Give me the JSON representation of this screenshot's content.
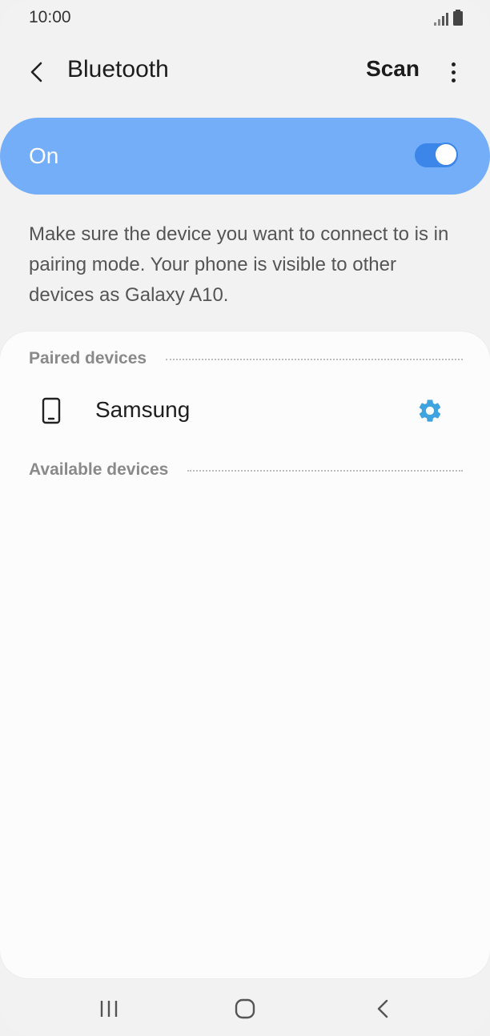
{
  "status_bar": {
    "time": "10:00",
    "signal_icon": "signal-icon",
    "battery_icon": "battery-icon"
  },
  "app_bar": {
    "back_icon": "chevron-left-icon",
    "title": "Bluetooth",
    "scan_label": "Scan",
    "more_icon": "more-vertical-icon"
  },
  "bluetooth_toggle": {
    "label": "On",
    "state": "on",
    "accent": "#74aef8",
    "switch_color": "#3b86e8"
  },
  "info": {
    "text": "Make sure the device you want to connect to is in pairing mode. Your phone is visible to other devices as Galaxy A10."
  },
  "paired_devices": {
    "header": "Paired devices",
    "items": [
      {
        "name": "Samsung",
        "icon": "phone-icon",
        "settings_icon": "gear-icon",
        "settings_color": "#3fa3e0"
      }
    ]
  },
  "available_devices": {
    "header": "Available devices",
    "items": []
  },
  "nav_bar": {
    "recents_icon": "recents-icon",
    "home_icon": "home-icon",
    "back_icon": "back-icon"
  }
}
